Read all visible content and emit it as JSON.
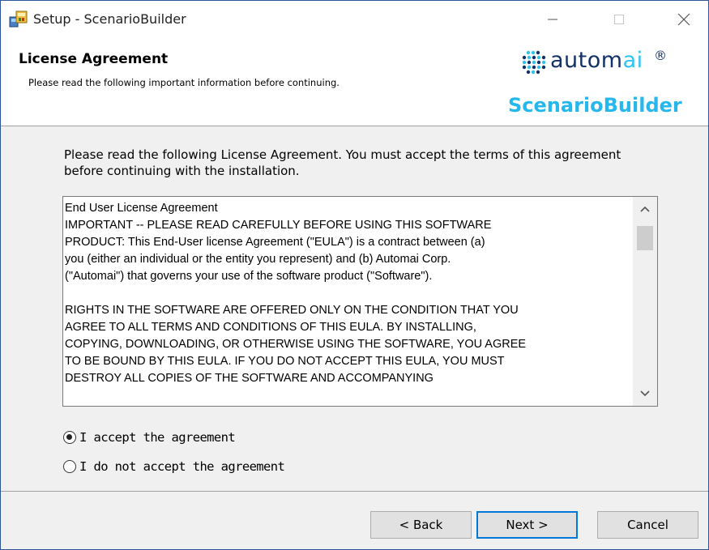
{
  "window": {
    "title": "Setup - ScenarioBuilder"
  },
  "header": {
    "title": "License Agreement",
    "subtitle": "Please read the following important information before continuing.",
    "logo_text_main": "autom",
    "logo_text_accent": "ai",
    "logo_reg": "®",
    "product_name": "ScenarioBuilder"
  },
  "intro": "Please read the following License Agreement. You must accept the terms of this agreement before continuing with the installation.",
  "license": {
    "text": "End User License Agreement\nIMPORTANT -- PLEASE READ CAREFULLY BEFORE USING THIS SOFTWARE\nPRODUCT: This End-User license Agreement (\"EULA\") is a contract between (a)\nyou (either an individual or the entity you represent) and (b) Automai Corp.\n(\"Automai\") that governs your use of the software product (\"Software\").\n\nRIGHTS IN THE SOFTWARE ARE OFFERED ONLY ON THE CONDITION THAT YOU\nAGREE TO ALL TERMS AND CONDITIONS OF THIS EULA. BY INSTALLING,\nCOPYING, DOWNLOADING, OR OTHERWISE USING THE SOFTWARE, YOU AGREE\nTO BE BOUND BY THIS EULA. IF YOU DO NOT ACCEPT THIS EULA, YOU MUST\nDESTROY ALL COPIES OF THE SOFTWARE AND ACCOMPANYING"
  },
  "options": {
    "accept_label": "I accept the agreement",
    "decline_label": "I do not accept the agreement",
    "selected": "accept"
  },
  "buttons": {
    "back": "< Back",
    "next": "Next >",
    "cancel": "Cancel"
  },
  "colors": {
    "logo_dark": "#123166",
    "logo_accent": "#2ec4ee",
    "product_name": "#26b8ec",
    "focus_border": "#0078d7"
  }
}
